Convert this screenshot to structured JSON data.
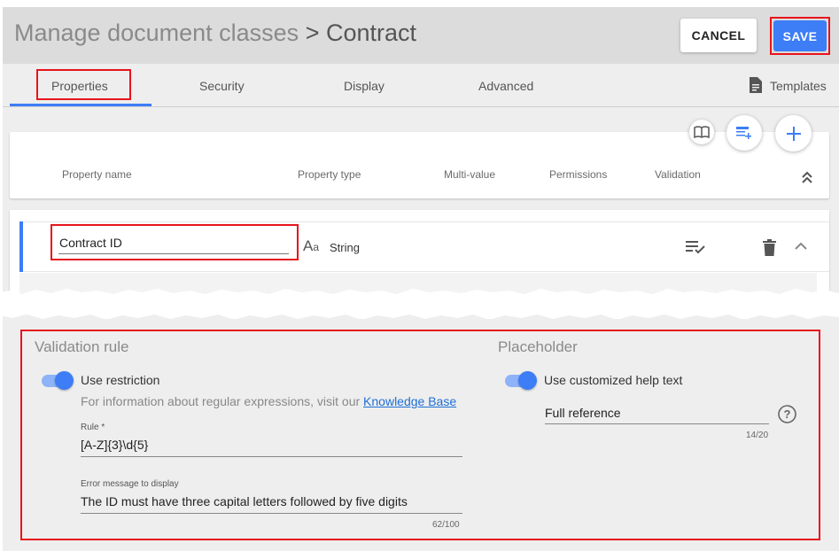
{
  "header": {
    "breadcrumb_parent": "Manage document classes",
    "breadcrumb_separator": ">",
    "breadcrumb_current": "Contract",
    "cancel_label": "CANCEL",
    "save_label": "SAVE"
  },
  "tabs": [
    {
      "label": "Properties",
      "active": true
    },
    {
      "label": "Security",
      "active": false
    },
    {
      "label": "Display",
      "active": false
    },
    {
      "label": "Advanced",
      "active": false
    }
  ],
  "templates_label": "Templates",
  "columns": {
    "property_name": "Property name",
    "property_type": "Property type",
    "multi_value": "Multi-value",
    "permissions": "Permissions",
    "validation": "Validation"
  },
  "toolbar_icons": [
    "book-open-icon",
    "table-add-icon",
    "plus-icon"
  ],
  "property_row": {
    "name": "Contract ID",
    "type_icon": "Aa",
    "type": "String"
  },
  "validation": {
    "title": "Validation rule",
    "use_restriction_label": "Use restriction",
    "use_restriction_on": true,
    "info_text": "For information about regular expressions, visit our",
    "info_link": "Knowledge Base",
    "rule_label": "Rule *",
    "rule_value": "[A-Z]{3}\\d{5}",
    "error_label": "Error message to display",
    "error_value": "The ID must have three capital letters followed by five digits",
    "error_counter": "62/100"
  },
  "placeholder": {
    "title": "Placeholder",
    "use_custom_label": "Use customized help text",
    "use_custom_on": true,
    "help_value": "Full reference",
    "help_counter": "14/20"
  },
  "colors": {
    "accent": "#3d7df6",
    "highlight": "#e8141c"
  }
}
